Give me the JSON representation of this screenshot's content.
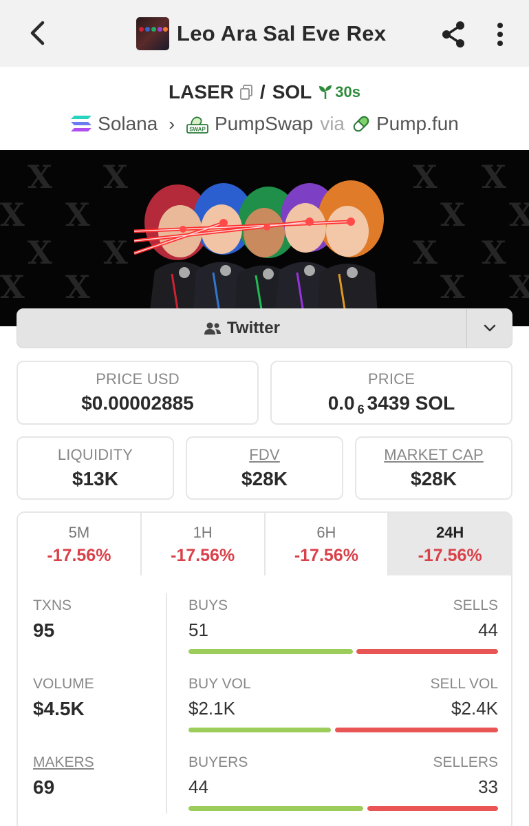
{
  "header": {
    "title": "Leo Ara Sal Eve Rex",
    "back_icon": "arrow-left-icon",
    "share_icon": "share-icon",
    "more_icon": "more-vertical-icon"
  },
  "pair": {
    "base": "LASER",
    "quote": "SOL",
    "separator": "/",
    "age": "30s",
    "chain": "Solana",
    "dex": "PumpSwap",
    "dex_badge": "SWAP",
    "via": "via",
    "launchpad": "Pump.fun"
  },
  "links": {
    "twitter_label": "Twitter"
  },
  "prices": {
    "price_usd_label": "PRICE USD",
    "price_usd": "$0.00002885",
    "price_label": "PRICE",
    "price_prefix": "0.0",
    "price_zeros": "6",
    "price_digits": "3439 SOL"
  },
  "metrics": {
    "liquidity_label": "LIQUIDITY",
    "liquidity": "$13K",
    "fdv_label": "FDV",
    "fdv": "$28K",
    "mcap_label": "MARKET CAP",
    "mcap": "$28K"
  },
  "timeframes": [
    {
      "label": "5M",
      "change": "-17.56%"
    },
    {
      "label": "1H",
      "change": "-17.56%"
    },
    {
      "label": "6H",
      "change": "-17.56%"
    },
    {
      "label": "24H",
      "change": "-17.56%",
      "active": true
    }
  ],
  "stats": {
    "txns_label": "TXNS",
    "txns": "95",
    "volume_label": "VOLUME",
    "volume": "$4.5K",
    "makers_label": "MAKERS",
    "makers": "69",
    "buys_label": "BUYS",
    "sells_label": "SELLS",
    "buys": "51",
    "sells": "44",
    "buy_vol_label": "BUY VOL",
    "sell_vol_label": "SELL VOL",
    "buy_vol": "$2.1K",
    "sell_vol": "$2.4K",
    "buyers_label": "BUYERS",
    "sellers_label": "SELLERS",
    "buyers": "44",
    "sellers": "33",
    "buys_fraction": 0.537,
    "buy_vol_fraction": 0.467,
    "buyers_fraction": 0.571
  },
  "colors": {
    "positive": "#9ccd5a",
    "negative": "#e95455",
    "change_text": "#d9414a",
    "age_green": "#2e8b3b"
  }
}
